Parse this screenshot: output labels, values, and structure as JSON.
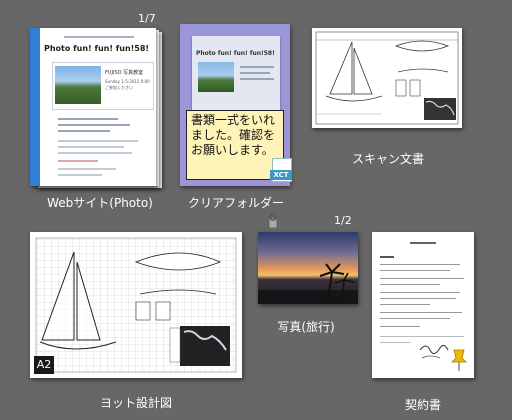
{
  "items": [
    {
      "label": "Webサイト(Photo)",
      "counter": "1/7",
      "site": {
        "title": "Photo fun! fun! fun!58!",
        "card_title": "FUJISO 写真教室",
        "card_text": "Sunday 1-5-2012 0:00 ご参加ください"
      }
    },
    {
      "label": "クリアフォルダー",
      "note": "書類一式をいれました。確認をお願いします。",
      "badge": "XCT"
    },
    {
      "label": "スキャン文書"
    },
    {
      "label": "ヨット設計図",
      "size_badge": "A2"
    },
    {
      "label": "写真(旅行)",
      "counter": "1/2"
    },
    {
      "label": "契約書"
    }
  ],
  "colors": {
    "background": "#676767",
    "folder": "#9a96d8",
    "note": "#fff4b8",
    "badge": "#3a97c9"
  },
  "icons": [
    "clip-icon",
    "pin-icon"
  ]
}
